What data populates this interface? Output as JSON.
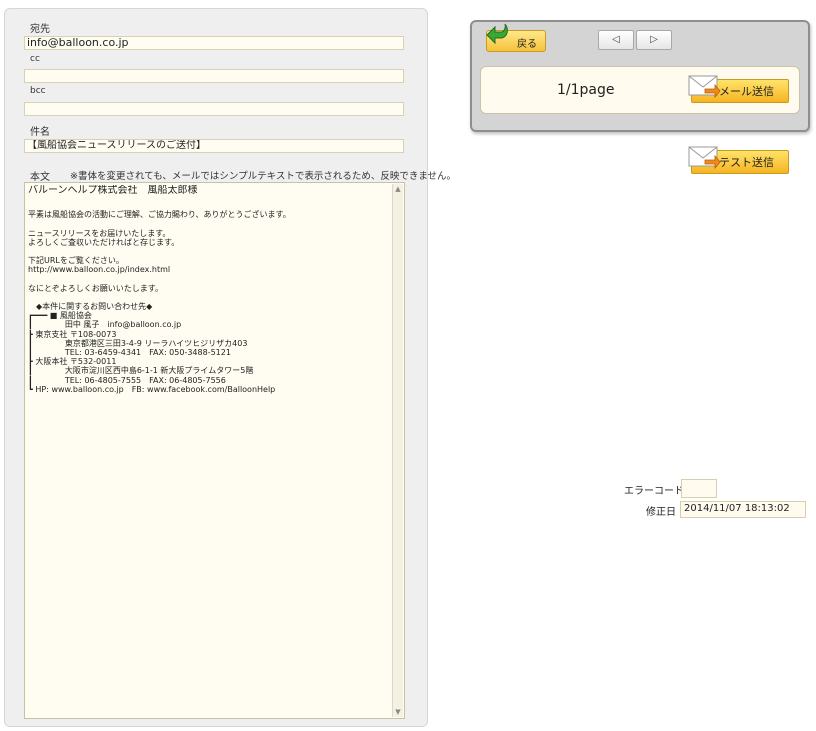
{
  "form": {
    "to_label": "宛先",
    "to_value": "info@balloon.co.jp",
    "cc_label": "cc",
    "cc_value": "",
    "bcc_label": "bcc",
    "bcc_value": "",
    "subject_label": "件名",
    "subject_value": "【風船協会ニュースリリースのご送付】",
    "body_label": "本文",
    "body_note": "※書体を変更されても、メールではシンプルテキストで表示されるため、反映できません。",
    "body_lines": [
      "バルーンヘルプ株式会社　風船太郎様",
      "",
      "平素は風船協会の活動にご理解、ご協力賜わり、ありがとうございます。",
      "",
      "ニュースリリースをお届けいたします。",
      "よろしくご査収いただければと存じます。",
      "",
      "下記URLをご覧ください。",
      "http://www.balloon.co.jp/index.html",
      "",
      "なにとぞよろしくお願いいたします。",
      "",
      "　◆本件に関するお問い合わせ先◆",
      "┏━━━ ■ 風船協会",
      "┃　　　　田中 風子　info@balloon.co.jp",
      "┣ 東京支社 〒108-0073",
      "┃　　　　東京都港区三田3-4-9 リーラハイツヒジリザカ403",
      "┃　　　　TEL: 03-6459-4341　FAX: 050-3488-5121",
      "┣ 大阪本社 〒532-0011",
      "┃　　　　大阪市淀川区西中島6-1-1 新大阪プライムタワー5階",
      "┃　　　　TEL: 06-4805-7555　FAX: 06-4805-7556",
      "┗ HP: www.balloon.co.jp　FB: www.facebook.com/BalloonHelp"
    ]
  },
  "nav": {
    "back_label": "戻る",
    "prev_symbol": "◁",
    "next_symbol": "▷",
    "page_label": "1/1page",
    "send_mail_label": "メール送信",
    "test_send_label": "テスト送信"
  },
  "status": {
    "error_code_label": "エラーコード",
    "error_code_value": "",
    "modified_label": "修正日",
    "modified_value": "2014/11/07 18:13:02"
  },
  "colors": {
    "button_yellow": "#f6b422",
    "field_bg": "#fffdf2",
    "panel_bg": "#efefef",
    "back_arrow_green": "#3aa635"
  }
}
